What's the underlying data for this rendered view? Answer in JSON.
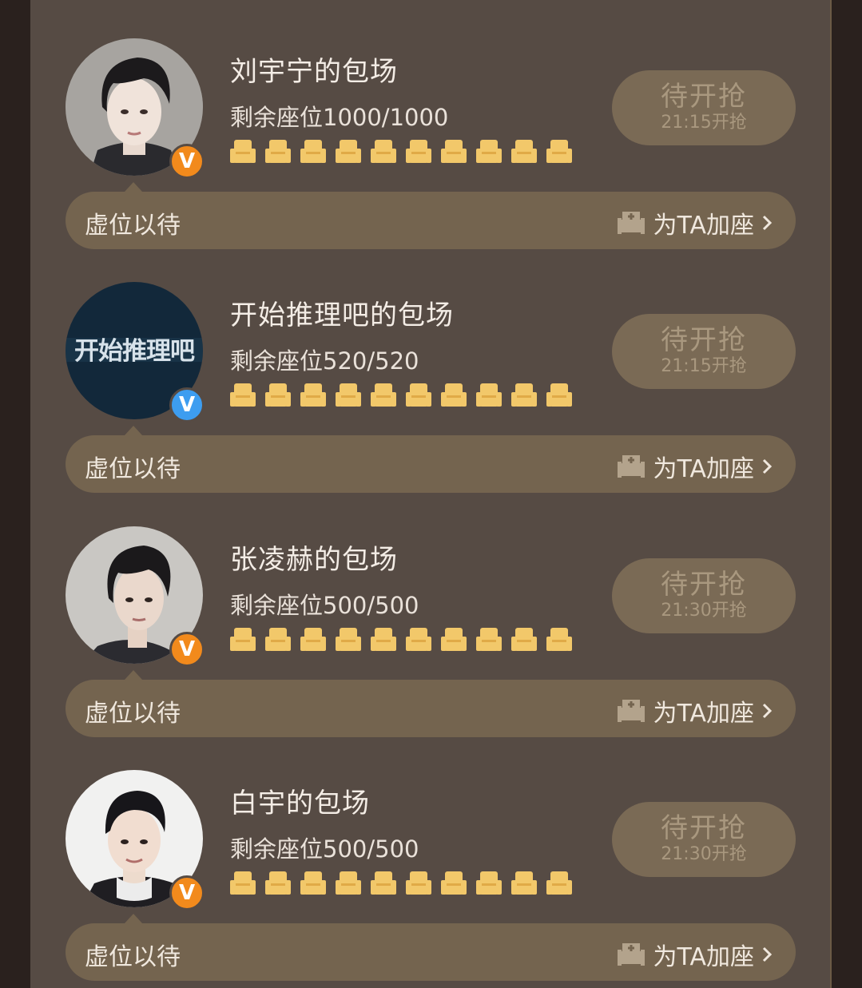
{
  "colors": {
    "panel": "#564b44",
    "bar": "#74644f",
    "button": "#7a6a55",
    "button_text": "#a9987f",
    "seat": "#f2c86a",
    "verified_orange": "#f28a1c",
    "verified_blue": "#3d9df0"
  },
  "cards": [
    {
      "title": "刘宇宁的包场",
      "seats_label": "剩余座位1000/1000",
      "button_main": "待开抢",
      "button_time": "21:15开抢",
      "wait_label": "虚位以待",
      "add_seat_label": "为TA加座",
      "badge_icon": "verified-v-icon",
      "badge_color": "orange"
    },
    {
      "title": "开始推理吧的包场",
      "seats_label": "剩余座位520/520",
      "button_main": "待开抢",
      "button_time": "21:15开抢",
      "wait_label": "虚位以待",
      "add_seat_label": "为TA加座",
      "avatar_logo_text": "开始推理吧",
      "badge_icon": "verified-v-icon",
      "badge_color": "blue"
    },
    {
      "title": "张凌赫的包场",
      "seats_label": "剩余座位500/500",
      "button_main": "待开抢",
      "button_time": "21:30开抢",
      "wait_label": "虚位以待",
      "add_seat_label": "为TA加座",
      "badge_icon": "verified-v-icon",
      "badge_color": "orange"
    },
    {
      "title": "白宇的包场",
      "seats_label": "剩余座位500/500",
      "button_main": "待开抢",
      "button_time": "21:30开抢",
      "wait_label": "虚位以待",
      "add_seat_label": "为TA加座",
      "badge_icon": "verified-v-icon",
      "badge_color": "orange"
    }
  ]
}
